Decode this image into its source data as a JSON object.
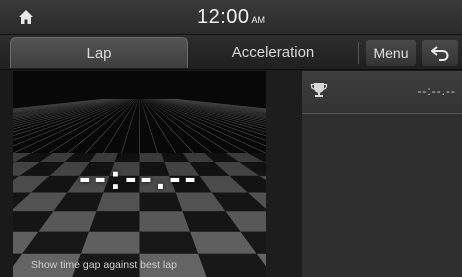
{
  "status": {
    "time": "12:00",
    "ampm": "AM"
  },
  "tabs": {
    "lap": "Lap",
    "acceleration": "Acceleration",
    "menu": "Menu"
  },
  "lap": {
    "current_time": "--:--.--",
    "hint": "Show time gap against best lap"
  },
  "records": {
    "best_time": "--:--.--"
  },
  "icons": {
    "home": "home-icon",
    "back": "back-arrow-icon",
    "trophy": "trophy-icon"
  }
}
